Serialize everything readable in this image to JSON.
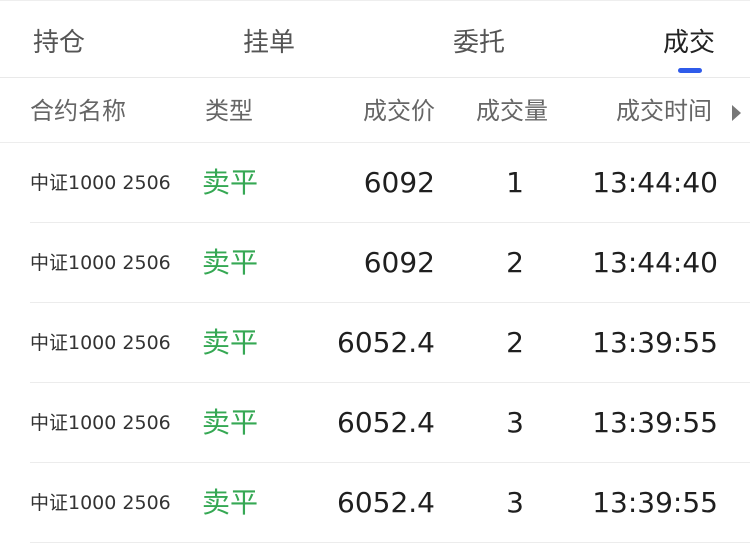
{
  "tabs": [
    {
      "label": "持仓",
      "active": false
    },
    {
      "label": "挂单",
      "active": false
    },
    {
      "label": "委托",
      "active": false
    },
    {
      "label": "成交",
      "active": true
    }
  ],
  "columns": {
    "contract": "合约名称",
    "type": "类型",
    "price": "成交价",
    "quantity": "成交量",
    "time": "成交时间"
  },
  "icons": {
    "scroll_right": "caret-right-icon"
  },
  "colors": {
    "sell_close": "#36a854",
    "active_tab_indicator": "#2f5bea"
  },
  "rows": [
    {
      "contract": "中证1000 2506",
      "type": "卖平",
      "price": "6092",
      "quantity": "1",
      "time": "13:44:40"
    },
    {
      "contract": "中证1000 2506",
      "type": "卖平",
      "price": "6092",
      "quantity": "2",
      "time": "13:44:40"
    },
    {
      "contract": "中证1000 2506",
      "type": "卖平",
      "price": "6052.4",
      "quantity": "2",
      "time": "13:39:55"
    },
    {
      "contract": "中证1000 2506",
      "type": "卖平",
      "price": "6052.4",
      "quantity": "3",
      "time": "13:39:55"
    },
    {
      "contract": "中证1000 2506",
      "type": "卖平",
      "price": "6052.4",
      "quantity": "3",
      "time": "13:39:55"
    }
  ]
}
